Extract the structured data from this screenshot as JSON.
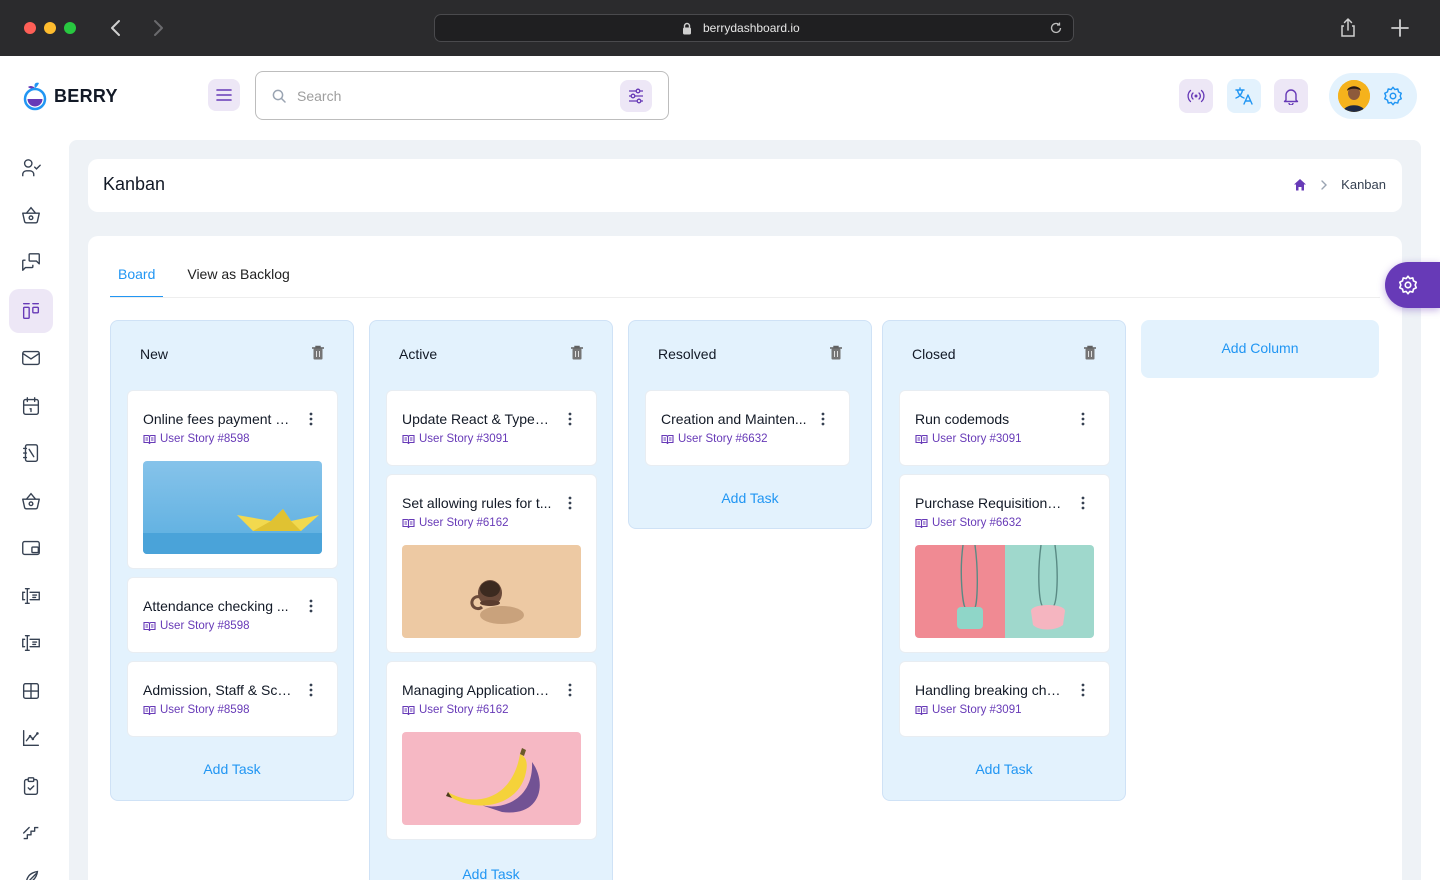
{
  "browser": {
    "url": "berrydashboard.io"
  },
  "app": {
    "brand": "BERRY"
  },
  "search": {
    "placeholder": "Search"
  },
  "page": {
    "title": "Kanban",
    "breadcrumb_current": "Kanban"
  },
  "tabs": [
    {
      "label": "Board"
    },
    {
      "label": "View as Backlog"
    }
  ],
  "columns": [
    {
      "title": "New",
      "add_label": "Add Task",
      "tasks": [
        {
          "title": "Online fees payment &...",
          "story": "User Story #8598",
          "image": "paper-boat"
        },
        {
          "title": "Attendance checking ...",
          "story": "User Story #8598"
        },
        {
          "title": "Admission, Staff & Sch...",
          "story": "User Story #8598"
        }
      ]
    },
    {
      "title": "Active",
      "add_label": "Add Task",
      "tasks": [
        {
          "title": "Update React & TypeS...",
          "story": "User Story #3091"
        },
        {
          "title": "Set allowing rules for t...",
          "story": "User Story #6162",
          "image": "coffee-mug"
        },
        {
          "title": "Managing Applications...",
          "story": "User Story #6162",
          "image": "banana"
        }
      ]
    },
    {
      "title": "Resolved",
      "add_label": "Add Task",
      "tasks": [
        {
          "title": "Creation and Mainten...",
          "story": "User Story #6632"
        }
      ]
    },
    {
      "title": "Closed",
      "add_label": "Add Task",
      "tasks": [
        {
          "title": "Run codemods",
          "story": "User Story #3091"
        },
        {
          "title": "Purchase Requisitions,...",
          "story": "User Story #6632",
          "image": "bags"
        },
        {
          "title": "Handling breaking cha...",
          "story": "User Story #3091"
        }
      ]
    }
  ],
  "add_column_label": "Add Column",
  "colors": {
    "primary": "#2196f3",
    "secondary": "#673ab7",
    "column_bg": "#e3f2fd",
    "main_bg": "#eef2f6"
  },
  "sidebar_icons": [
    "user-check-icon",
    "basket-icon",
    "messages-icon",
    "kanban-icon",
    "mail-icon",
    "calendar-icon",
    "notebook-icon",
    "basket-icon",
    "wallet-icon",
    "invoice-icon",
    "invoice-icon",
    "table-icon",
    "chart-icon",
    "clipboard-icon",
    "stairs-icon",
    "feather-icon"
  ]
}
